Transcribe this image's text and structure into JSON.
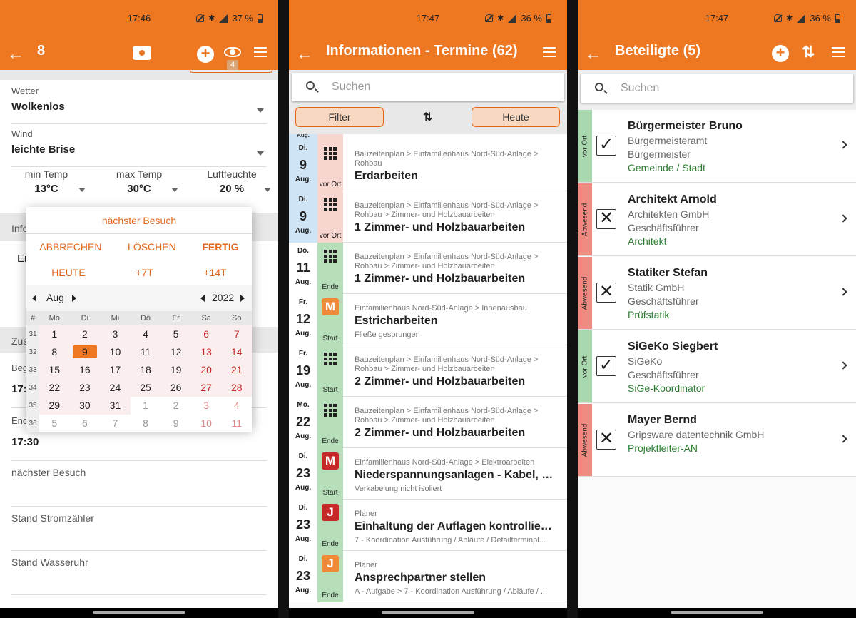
{
  "screen1": {
    "status": {
      "time": "17:46",
      "battery": "37 %"
    },
    "appbar": {
      "back": "←",
      "title": "8",
      "badge": "4"
    },
    "wetter": {
      "label": "Wetter",
      "value": "Wolkenlos"
    },
    "wind": {
      "label": "Wind",
      "value": "leichte Brise"
    },
    "temps": [
      {
        "label": "min Temp",
        "value": "13°C"
      },
      {
        "label": "max Temp",
        "value": "30°C"
      },
      {
        "label": "Luftfeuchte",
        "value": "20 %"
      }
    ],
    "partials": {
      "info": "Info",
      "er": "Er",
      "zus": "Zus",
      "beg": "Beg",
      "begval": "17:",
      "end": "End"
    },
    "end_value": "17:30",
    "fields": [
      "nächster Besuch",
      "Stand Stromzähler",
      "Stand Wasseruhr"
    ],
    "dialog": {
      "title": "nächster Besuch",
      "actions": [
        "ABBRECHEN",
        "LÖSCHEN",
        "FERTIG"
      ],
      "quick": [
        "HEUTE",
        "+7T",
        "+14T"
      ],
      "month": "Aug",
      "year": "2022",
      "weekday_header": [
        "#",
        "Mo",
        "Di",
        "Mi",
        "Do",
        "Fr",
        "Sa",
        "So"
      ],
      "weeks": [
        {
          "wk": "31",
          "days": [
            "1",
            "2",
            "3",
            "4",
            "5",
            "6",
            "7"
          ]
        },
        {
          "wk": "32",
          "days": [
            "8",
            "9",
            "10",
            "11",
            "12",
            "13",
            "14"
          ]
        },
        {
          "wk": "33",
          "days": [
            "15",
            "16",
            "17",
            "18",
            "19",
            "20",
            "21"
          ]
        },
        {
          "wk": "34",
          "days": [
            "22",
            "23",
            "24",
            "25",
            "26",
            "27",
            "28"
          ]
        },
        {
          "wk": "35",
          "days": [
            "29",
            "30",
            "31",
            "1",
            "2",
            "3",
            "4"
          ]
        },
        {
          "wk": "36",
          "days": [
            "5",
            "6",
            "7",
            "8",
            "9",
            "10",
            "11"
          ]
        }
      ],
      "selected": "9"
    }
  },
  "screen2": {
    "status": {
      "time": "17:47",
      "battery": "36 %"
    },
    "appbar": {
      "back": "←",
      "title": "Informationen - Termine (62)"
    },
    "search_placeholder": "Suchen",
    "filter_label": "Filter",
    "today_label": "Heute",
    "partial_top": "Aug.",
    "items": [
      {
        "wd": "Di.",
        "day": "9",
        "mo": "Aug.",
        "dcolor": "#cfe4f5",
        "scolor": "#f8d6d0",
        "icon": "grid",
        "state": "vor Ort",
        "path": "Bauzeitenplan > Einfamilienhaus Nord-Süd-Anlage > Rohbau",
        "title": "Erdarbeiten",
        "sub": ""
      },
      {
        "wd": "Di.",
        "day": "9",
        "mo": "Aug.",
        "dcolor": "#cfe4f5",
        "scolor": "#f8d6d0",
        "icon": "grid",
        "state": "vor Ort",
        "path": "Bauzeitenplan > Einfamilienhaus Nord-Süd-Anlage > Rohbau > Zimmer- und Holzbauarbeiten",
        "title": "1 Zimmer- und Holzbauarbeiten",
        "sub": ""
      },
      {
        "wd": "Do.",
        "day": "11",
        "mo": "Aug.",
        "dcolor": "#ffffff",
        "scolor": "#b5deb9",
        "icon": "grid",
        "state": "Ende",
        "path": "Bauzeitenplan > Einfamilienhaus Nord-Süd-Anlage > Rohbau > Zimmer- und Holzbauarbeiten",
        "title": "1 Zimmer- und Holzbauarbeiten",
        "sub": ""
      },
      {
        "wd": "Fr.",
        "day": "12",
        "mo": "Aug.",
        "dcolor": "#ffffff",
        "scolor": "#b5deb9",
        "icon": "M",
        "iconcolor": "#f08a3a",
        "state": "Start",
        "path": "Einfamilienhaus Nord-Süd-Anlage > Innenausbau",
        "title": "Estricharbeiten",
        "sub": "Fließe gesprungen"
      },
      {
        "wd": "Fr.",
        "day": "19",
        "mo": "Aug.",
        "dcolor": "#ffffff",
        "scolor": "#b5deb9",
        "icon": "grid",
        "state": "Start",
        "path": "Bauzeitenplan > Einfamilienhaus Nord-Süd-Anlage > Rohbau > Zimmer- und Holzbauarbeiten",
        "title": "2 Zimmer- und Holzbauarbeiten",
        "sub": ""
      },
      {
        "wd": "Mo.",
        "day": "22",
        "mo": "Aug.",
        "dcolor": "#ffffff",
        "scolor": "#b5deb9",
        "icon": "grid",
        "state": "Ende",
        "path": "Bauzeitenplan > Einfamilienhaus Nord-Süd-Anlage > Rohbau > Zimmer- und Holzbauarbeiten",
        "title": "2 Zimmer- und Holzbauarbeiten",
        "sub": ""
      },
      {
        "wd": "Di.",
        "day": "23",
        "mo": "Aug.",
        "dcolor": "#ffffff",
        "scolor": "#b5deb9",
        "icon": "M",
        "iconcolor": "#c62828",
        "state": "Start",
        "path": "Einfamilienhaus Nord-Süd-Anlage > Elektroarbeiten",
        "title": "Niederspannungsanlagen - Kabel, V...",
        "sub": "Verkabelung nicht isoliert"
      },
      {
        "wd": "Di.",
        "day": "23",
        "mo": "Aug.",
        "dcolor": "#ffffff",
        "scolor": "#b5deb9",
        "icon": "J",
        "iconcolor": "#c62828",
        "state": "Ende",
        "path": "Planer",
        "title": "Einhaltung der Auflagen kontrollieren",
        "sub": "7 - Koordination Ausführung / Abläufe / Detailterminpl..."
      },
      {
        "wd": "Di.",
        "day": "23",
        "mo": "Aug.",
        "dcolor": "#ffffff",
        "scolor": "#b5deb9",
        "icon": "J",
        "iconcolor": "#f08a3a",
        "state": "Ende",
        "path": "Planer",
        "title": "Ansprechpartner stellen",
        "sub": "A - Aufgabe > 7 - Koordination Ausführung / Abläufe / ..."
      }
    ]
  },
  "screen3": {
    "status": {
      "time": "17:47",
      "battery": "36 %"
    },
    "appbar": {
      "back": "←",
      "title": "Beteiligte (5)"
    },
    "search_placeholder": "Suchen",
    "people": [
      {
        "status": "vor Ort",
        "scolor": "#a8d8ad",
        "mark": "✓",
        "name": "Bürgermeister Bruno",
        "lines": [
          "Bürgermeisteramt",
          "Bürgermeister"
        ],
        "role": "Gemeinde / Stadt"
      },
      {
        "status": "Abwesend",
        "scolor": "#ef8b80",
        "mark": "✕",
        "name": "Architekt Arnold",
        "lines": [
          "Architekten GmbH",
          "Geschäftsführer"
        ],
        "role": "Architekt"
      },
      {
        "status": "Abwesend",
        "scolor": "#ef8b80",
        "mark": "✕",
        "name": "Statiker Stefan",
        "lines": [
          "Statik GmbH",
          "Geschäftsführer"
        ],
        "role": "Prüfstatik"
      },
      {
        "status": "vor Ort",
        "scolor": "#a8d8ad",
        "mark": "✓",
        "name": "SiGeKo Siegbert",
        "lines": [
          "SiGeKo",
          "Geschäftsführer"
        ],
        "role": "SiGe-Koordinator"
      },
      {
        "status": "Abwesend",
        "scolor": "#ef8b80",
        "mark": "✕",
        "name": "Mayer Bernd",
        "lines": [
          "Gripsware datentechnik GmbH"
        ],
        "role": "Projektleiter-AN"
      }
    ]
  },
  "colors": {
    "accent": "#ee7722",
    "green": "#2e7d32",
    "red": "#c62828"
  }
}
